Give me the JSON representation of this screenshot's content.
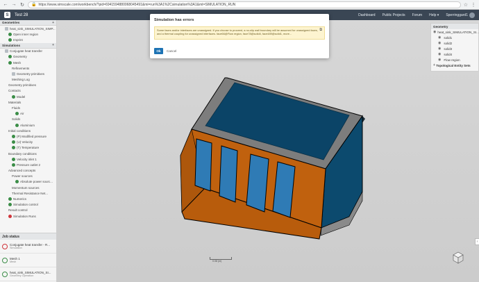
{
  "browser": {
    "url": "https://www.simscale.com/workbench/?pid=6941594880068045491&mi=run%3A1%2Csimulation%3A1&mt=SIMULATION_RUN"
  },
  "header": {
    "project": "Test 28",
    "nav": [
      "Dashboard",
      "Public Projects",
      "Forum",
      "Help"
    ],
    "user": "Sperringgard1"
  },
  "left_tree": [
    {
      "type": "section",
      "label": "Geometries"
    },
    {
      "type": "item",
      "indent": 1,
      "icon": "plain",
      "label": "heat_sink_SIMULATION_SIMP..."
    },
    {
      "type": "item",
      "indent": 2,
      "icon": "ok",
      "label": "Open inner region"
    },
    {
      "type": "item",
      "indent": 2,
      "icon": "ok",
      "label": "Imprint"
    },
    {
      "type": "section",
      "label": "Simulations"
    },
    {
      "type": "item",
      "indent": 1,
      "icon": "plain",
      "label": "Conjugate heat transfer"
    },
    {
      "type": "item",
      "indent": 2,
      "icon": "ok",
      "label": "Geometry"
    },
    {
      "type": "item",
      "indent": 2,
      "icon": "ok",
      "label": "Mesh"
    },
    {
      "type": "item",
      "indent": 3,
      "icon": "none",
      "label": "Refinements"
    },
    {
      "type": "item",
      "indent": 3,
      "icon": "plain",
      "label": "Geometry primitives"
    },
    {
      "type": "item",
      "indent": 3,
      "icon": "none",
      "label": "Meshing Log"
    },
    {
      "type": "item",
      "indent": 2,
      "icon": "none",
      "label": "Geometry primitives"
    },
    {
      "type": "item",
      "indent": 2,
      "icon": "none",
      "label": "Contacts"
    },
    {
      "type": "item",
      "indent": 3,
      "icon": "ok",
      "label": "Model"
    },
    {
      "type": "item",
      "indent": 2,
      "icon": "none",
      "label": "Materials"
    },
    {
      "type": "item",
      "indent": 3,
      "icon": "none",
      "label": "Fluids"
    },
    {
      "type": "item",
      "indent": 4,
      "icon": "ok",
      "label": "Air"
    },
    {
      "type": "item",
      "indent": 3,
      "icon": "none",
      "label": "Solids"
    },
    {
      "type": "item",
      "indent": 4,
      "icon": "ok",
      "label": "Aluminium"
    },
    {
      "type": "item",
      "indent": 2,
      "icon": "none",
      "label": "Initial conditions"
    },
    {
      "type": "item",
      "indent": 3,
      "icon": "ok",
      "label": "(P) Modified pressure"
    },
    {
      "type": "item",
      "indent": 3,
      "icon": "ok",
      "label": "(U) Velocity"
    },
    {
      "type": "item",
      "indent": 3,
      "icon": "ok",
      "label": "(T) Temperature"
    },
    {
      "type": "item",
      "indent": 2,
      "icon": "none",
      "label": "Boundary conditions"
    },
    {
      "type": "item",
      "indent": 3,
      "icon": "ok",
      "label": "Velocity inlet 1"
    },
    {
      "type": "item",
      "indent": 3,
      "icon": "ok",
      "label": "Pressure outlet 2"
    },
    {
      "type": "item",
      "indent": 2,
      "icon": "none",
      "label": "Advanced concepts"
    },
    {
      "type": "item",
      "indent": 3,
      "icon": "none",
      "label": "Power sources"
    },
    {
      "type": "item",
      "indent": 4,
      "icon": "ok",
      "label": "Absolute power sourc..."
    },
    {
      "type": "item",
      "indent": 3,
      "icon": "none",
      "label": "Momentum sources"
    },
    {
      "type": "item",
      "indent": 3,
      "icon": "none",
      "label": "Thermal Resistance Net..."
    },
    {
      "type": "item",
      "indent": 2,
      "icon": "ok",
      "label": "Numerics"
    },
    {
      "type": "item",
      "indent": 2,
      "icon": "ok",
      "label": "Simulation control"
    },
    {
      "type": "item",
      "indent": 2,
      "icon": "none",
      "label": "Result control"
    },
    {
      "type": "item",
      "indent": 2,
      "icon": "err",
      "label": "Simulation Runs"
    }
  ],
  "jobs": {
    "title": "Job status",
    "items": [
      {
        "title": "Conjugate heat transfer - R...",
        "subtitle": "Simulation",
        "status": "red"
      },
      {
        "title": "Mesh 1",
        "subtitle": "Mesh",
        "status": "green"
      },
      {
        "title": "heat_sink_SIMULATION_SI...",
        "subtitle": "Geometry Operation",
        "status": "green"
      }
    ]
  },
  "right_panel": {
    "section": "Geometry",
    "root": "heat_sink_SIMULATION_SI...",
    "items": [
      "solid1",
      "solid2",
      "solid3",
      "solid4",
      "Flow region"
    ],
    "footer": "Topological Entity Sets"
  },
  "dialog": {
    "title": "Simulation has errors",
    "message": "Some faces and/or interfaces are unassigned. If you choose to proceed, a no-slip wall boundary will be assumed for unassigned faces, and a thermal coupling for unassigned interfaces. face66@Flow region, face78@solid4, face489@solid1, more...",
    "ok": "Ok",
    "cancel": "Cancel"
  },
  "viewer": {
    "scale": "0.08 (m)"
  },
  "colors": {
    "header": "#3a4654",
    "primary": "#1d73b4",
    "top_panel": "#0c4a6e",
    "side_orange": "#c0610e",
    "window_blue": "#2f7bb5"
  }
}
